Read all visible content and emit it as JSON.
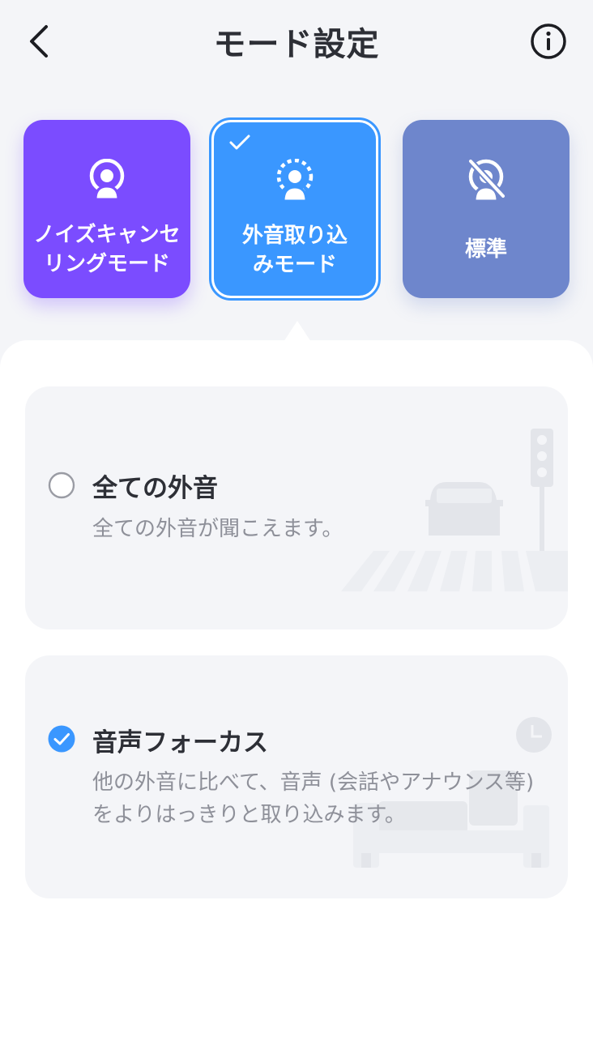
{
  "header": {
    "title": "モード設定",
    "back_icon": "chevron-left-icon",
    "info_icon": "info-icon"
  },
  "modes": [
    {
      "label": "ノイズキャンセ\nリングモード",
      "color": "#7B4CFF",
      "icon": "noise-cancel-icon",
      "selected": false
    },
    {
      "label": "外音取り込\nみモード",
      "color": "#3A97FF",
      "icon": "ambient-icon",
      "selected": true
    },
    {
      "label": "標準",
      "color": "#6E86CC",
      "icon": "standard-off-icon",
      "selected": false
    }
  ],
  "options": [
    {
      "title": "全ての外音",
      "description": "全ての外音が聞こえます。",
      "selected": false
    },
    {
      "title": "音声フォーカス",
      "description": "他の外音に比べて、音声 (会話やアナウンス等) をよりはっきりと取り込みます。",
      "selected": true
    }
  ],
  "colors": {
    "accent": "#3A97FF",
    "text": "#2D2F36",
    "subtext": "#8E9099"
  }
}
